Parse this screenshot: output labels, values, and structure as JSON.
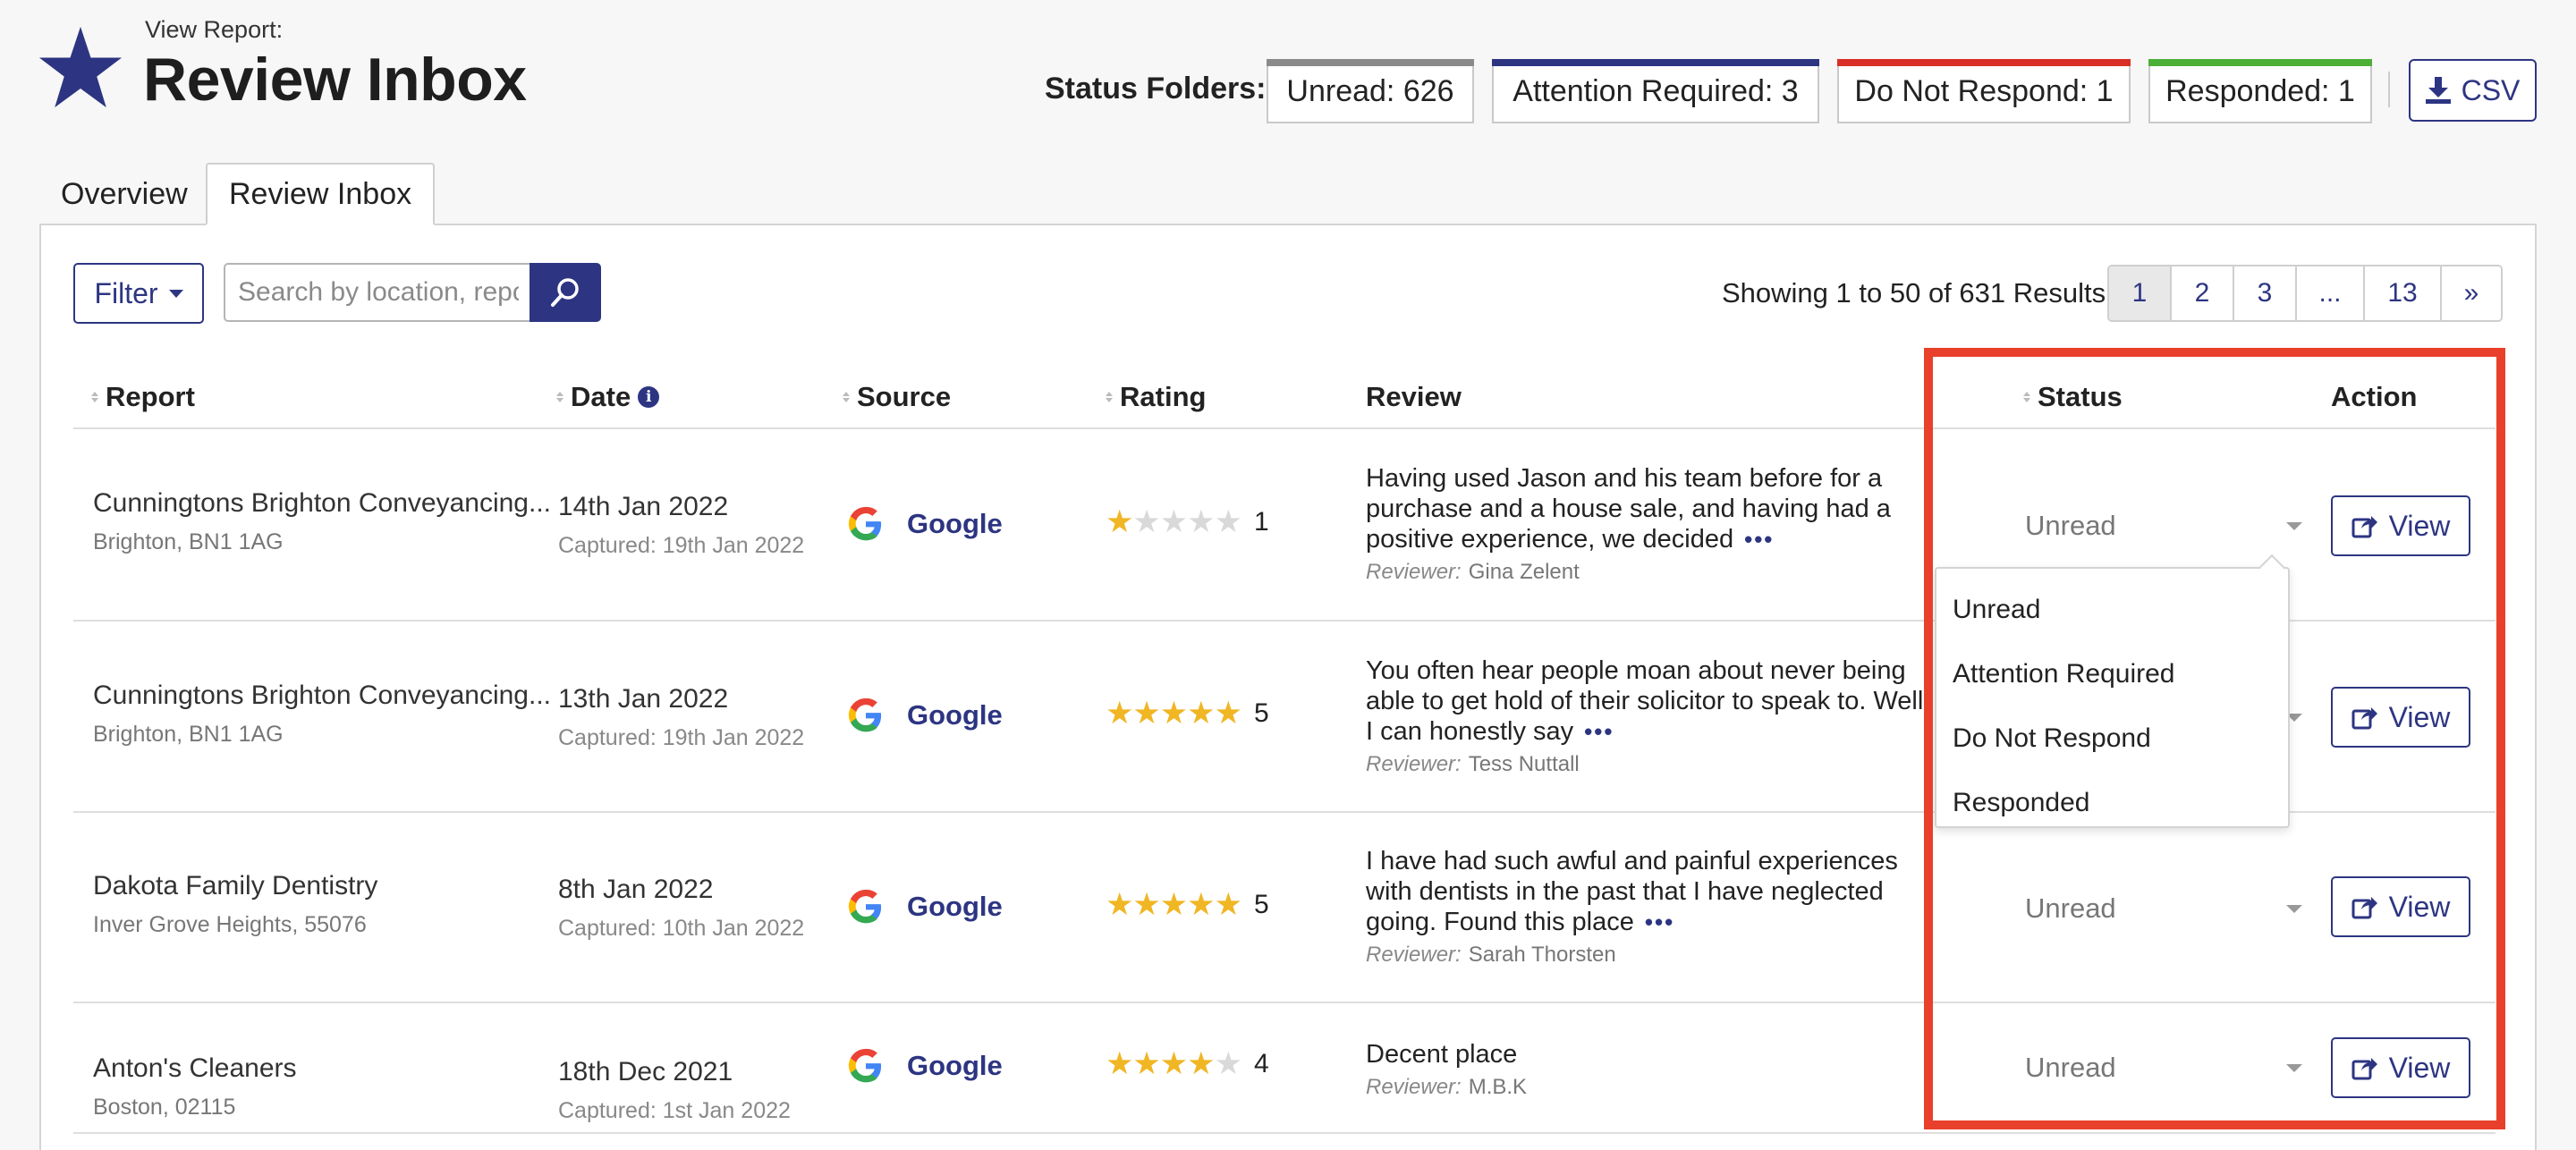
{
  "header": {
    "view_report_label": "View Report:",
    "title": "Review Inbox",
    "status_folders_label": "Status Folders:",
    "folders": [
      {
        "label": "Unread: 626",
        "color": "#8a8a8a"
      },
      {
        "label": "Attention Required: 3",
        "color": "#2d3582"
      },
      {
        "label": "Do Not Respond: 1",
        "color": "#d93025"
      },
      {
        "label": "Responded: 1",
        "color": "#4caf37"
      }
    ],
    "csv_label": "CSV"
  },
  "tabs": [
    {
      "label": "Overview",
      "active": false
    },
    {
      "label": "Review Inbox",
      "active": true
    }
  ],
  "toolbar": {
    "filter_label": "Filter",
    "search_placeholder": "Search by location, report",
    "showing_text": "Showing 1 to 50 of 631 Results",
    "pages": [
      "1",
      "2",
      "3",
      "...",
      "13",
      "»"
    ],
    "active_page": "1"
  },
  "table": {
    "headers": {
      "report": "Report",
      "date": "Date",
      "source": "Source",
      "rating": "Rating",
      "review": "Review",
      "status": "Status",
      "action": "Action"
    },
    "reviewer_label": "Reviewer:",
    "view_label": "View",
    "rows": [
      {
        "report": "Cunningtons Brighton Conveyancing...",
        "location": "Brighton, BN1 1AG",
        "date": "14th Jan 2022",
        "captured": "Captured: 19th Jan 2022",
        "source": "Google",
        "rating": 1,
        "rating_text": "1",
        "review": "Having used Jason and his team before for a purchase and a house sale, and having had a positive experience, we decided",
        "reviewer": "Gina Zelent",
        "status": "Unread"
      },
      {
        "report": "Cunningtons Brighton Conveyancing...",
        "location": "Brighton, BN1 1AG",
        "date": "13th Jan 2022",
        "captured": "Captured: 19th Jan 2022",
        "source": "Google",
        "rating": 5,
        "rating_text": "5",
        "review": "You often hear people moan about never being able to get hold of their solicitor to speak to. Well, I can honestly say",
        "reviewer": "Tess Nuttall",
        "status": "Unread"
      },
      {
        "report": "Dakota Family Dentistry",
        "location": "Inver Grove Heights, 55076",
        "date": "8th Jan 2022",
        "captured": "Captured: 10th Jan 2022",
        "source": "Google",
        "rating": 5,
        "rating_text": "5",
        "review": "I have had such awful and painful experiences with dentists in the past that I have neglected going. Found this place",
        "reviewer": "Sarah Thorsten",
        "status": "Unread"
      },
      {
        "report": "Anton's Cleaners",
        "location": "Boston, 02115",
        "date": "18th Dec 2021",
        "captured": "Captured: 1st Jan 2022",
        "source": "Google",
        "rating": 4,
        "rating_text": "4",
        "review": "Decent place",
        "reviewer": "M.B.K",
        "status": "Unread"
      }
    ]
  },
  "status_dropdown": {
    "options": [
      "Unread",
      "Attention Required",
      "Do Not Respond",
      "Responded"
    ]
  },
  "colors": {
    "brand": "#2d3582",
    "star": "#f0b623",
    "highlight": "#e8402a"
  }
}
